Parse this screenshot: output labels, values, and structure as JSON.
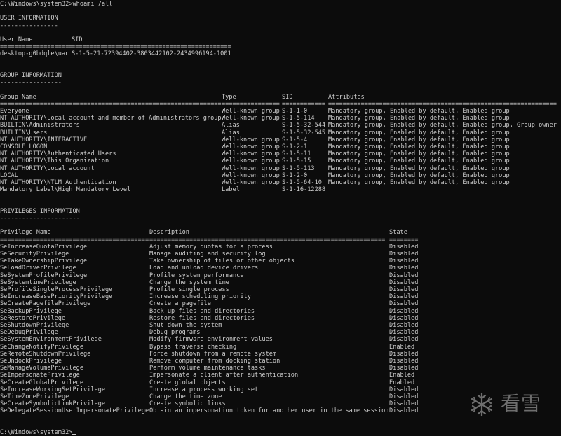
{
  "console": {
    "command_line": "C:\\Windows\\system32>whoami /all",
    "user_info": {
      "title": "USER INFORMATION",
      "title_underline": "----------------",
      "headers": [
        "User Name",
        "SID"
      ],
      "rule": [
        "====================",
        "============================================"
      ],
      "rows": [
        [
          "desktop-g0bdqle\\uac",
          "S-1-5-21-72394402-3803442102-2434996194-1001"
        ]
      ]
    },
    "group_info": {
      "title": "GROUP INFORMATION",
      "title_underline": "-----------------",
      "headers": [
        "Group Name",
        "Type",
        "SID",
        "Attributes"
      ],
      "rule": [
        "=============================================================",
        "================",
        "============",
        "==============================================================="
      ],
      "rows": [
        [
          "Everyone",
          "Well-known group",
          "S-1-1-0",
          "Mandatory group, Enabled by default, Enabled group"
        ],
        [
          "NT AUTHORITY\\Local account and member of Administrators group",
          "Well-known group",
          "S-1-5-114",
          "Mandatory group, Enabled by default, Enabled group"
        ],
        [
          "BUILTIN\\Administrators",
          "Alias",
          "S-1-5-32-544",
          "Mandatory group, Enabled by default, Enabled group, Group owner"
        ],
        [
          "BUILTIN\\Users",
          "Alias",
          "S-1-5-32-545",
          "Mandatory group, Enabled by default, Enabled group"
        ],
        [
          "NT AUTHORITY\\INTERACTIVE",
          "Well-known group",
          "S-1-5-4",
          "Mandatory group, Enabled by default, Enabled group"
        ],
        [
          "CONSOLE LOGON",
          "Well-known group",
          "S-1-2-1",
          "Mandatory group, Enabled by default, Enabled group"
        ],
        [
          "NT AUTHORITY\\Authenticated Users",
          "Well-known group",
          "S-1-5-11",
          "Mandatory group, Enabled by default, Enabled group"
        ],
        [
          "NT AUTHORITY\\This Organization",
          "Well-known group",
          "S-1-5-15",
          "Mandatory group, Enabled by default, Enabled group"
        ],
        [
          "NT AUTHORITY\\Local account",
          "Well-known group",
          "S-1-5-113",
          "Mandatory group, Enabled by default, Enabled group"
        ],
        [
          "LOCAL",
          "Well-known group",
          "S-1-2-0",
          "Mandatory group, Enabled by default, Enabled group"
        ],
        [
          "NT AUTHORITY\\NTLM Authentication",
          "Well-known group",
          "S-1-5-64-10",
          "Mandatory group, Enabled by default, Enabled group"
        ],
        [
          "Mandatory Label\\High Mandatory Level",
          "Label",
          "S-1-16-12288",
          ""
        ]
      ]
    },
    "privileges_info": {
      "title": "PRIVILEGES INFORMATION",
      "title_underline": "----------------------",
      "headers": [
        "Privilege Name",
        "Description",
        "State"
      ],
      "rule": [
        "=========================================",
        "=================================================================",
        "========"
      ],
      "rows": [
        [
          "SeIncreaseQuotaPrivilege",
          "Adjust memory quotas for a process",
          "Disabled"
        ],
        [
          "SeSecurityPrivilege",
          "Manage auditing and security log",
          "Disabled"
        ],
        [
          "SeTakeOwnershipPrivilege",
          "Take ownership of files or other objects",
          "Disabled"
        ],
        [
          "SeLoadDriverPrivilege",
          "Load and unload device drivers",
          "Disabled"
        ],
        [
          "SeSystemProfilePrivilege",
          "Profile system performance",
          "Disabled"
        ],
        [
          "SeSystemtimePrivilege",
          "Change the system time",
          "Disabled"
        ],
        [
          "SeProfileSingleProcessPrivilege",
          "Profile single process",
          "Disabled"
        ],
        [
          "SeIncreaseBasePriorityPrivilege",
          "Increase scheduling priority",
          "Disabled"
        ],
        [
          "SeCreatePagefilePrivilege",
          "Create a pagefile",
          "Disabled"
        ],
        [
          "SeBackupPrivilege",
          "Back up files and directories",
          "Disabled"
        ],
        [
          "SeRestorePrivilege",
          "Restore files and directories",
          "Disabled"
        ],
        [
          "SeShutdownPrivilege",
          "Shut down the system",
          "Disabled"
        ],
        [
          "SeDebugPrivilege",
          "Debug programs",
          "Disabled"
        ],
        [
          "SeSystemEnvironmentPrivilege",
          "Modify firmware environment values",
          "Disabled"
        ],
        [
          "SeChangeNotifyPrivilege",
          "Bypass traverse checking",
          "Enabled"
        ],
        [
          "SeRemoteShutdownPrivilege",
          "Force shutdown from a remote system",
          "Disabled"
        ],
        [
          "SeUndockPrivilege",
          "Remove computer from docking station",
          "Disabled"
        ],
        [
          "SeManageVolumePrivilege",
          "Perform volume maintenance tasks",
          "Disabled"
        ],
        [
          "SeImpersonatePrivilege",
          "Impersonate a client after authentication",
          "Enabled"
        ],
        [
          "SeCreateGlobalPrivilege",
          "Create global objects",
          "Enabled"
        ],
        [
          "SeIncreaseWorkingSetPrivilege",
          "Increase a process working set",
          "Disabled"
        ],
        [
          "SeTimeZonePrivilege",
          "Change the time zone",
          "Disabled"
        ],
        [
          "SeCreateSymbolicLinkPrivilege",
          "Create symbolic links",
          "Disabled"
        ],
        [
          "SeDelegateSessionUserImpersonatePrivilege",
          "Obtain an impersonation token for another user in the same session",
          "Disabled"
        ]
      ]
    },
    "prompt": "C:\\Windows\\system32>"
  },
  "watermark": {
    "icon": "snowflake-icon",
    "text": "看雪",
    "color": "#6e6e6e"
  },
  "colors": {
    "background": "#0c0c0c",
    "foreground": "#cccccc"
  }
}
